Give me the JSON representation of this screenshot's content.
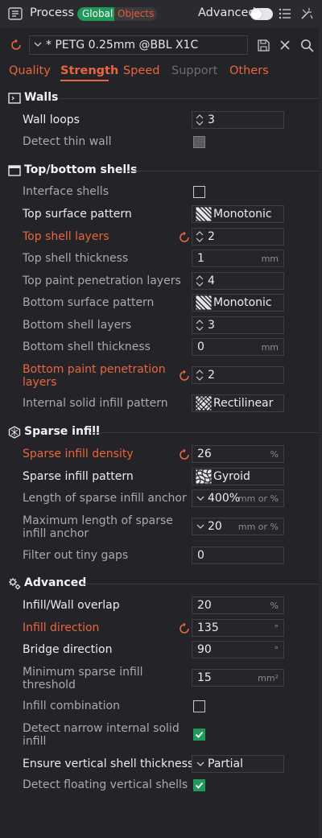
{
  "header": {
    "title": "Process",
    "seg_global": "Global",
    "seg_objects": "Objects",
    "advanced_label": "Advanced"
  },
  "preset": {
    "name": "* PETG 0.25mm @BBL X1C"
  },
  "tabs": [
    {
      "label": "Quality"
    },
    {
      "label": "Strength"
    },
    {
      "label": "Speed"
    },
    {
      "label": "Support"
    },
    {
      "label": "Others"
    }
  ],
  "sections": {
    "walls": "Walls",
    "topbottom": "Top/bottom shells",
    "sparse": "Sparse infill",
    "advanced": "Advanced"
  },
  "walls": {
    "wall_loops_label": "Wall loops",
    "wall_loops_value": "3",
    "detect_thin_label": "Detect thin wall"
  },
  "topbottom": {
    "interface_label": "Interface shells",
    "top_pattern_label": "Top surface pattern",
    "top_pattern_value": "Monotonic",
    "top_layers_label": "Top shell layers",
    "top_layers_value": "2",
    "top_thickness_label": "Top shell thickness",
    "top_thickness_value": "1",
    "top_thickness_unit": "mm",
    "top_paint_label": "Top paint penetration layers",
    "top_paint_value": "4",
    "bottom_pattern_label": "Bottom surface pattern",
    "bottom_pattern_value": "Monotonic",
    "bottom_layers_label": "Bottom shell layers",
    "bottom_layers_value": "3",
    "bottom_thickness_label": "Bottom shell thickness",
    "bottom_thickness_value": "0",
    "bottom_thickness_unit": "mm",
    "bottom_paint_label": "Bottom paint penetration layers",
    "bottom_paint_value": "2",
    "internal_pattern_label": "Internal solid infill pattern",
    "internal_pattern_value": "Rectilinear"
  },
  "sparse": {
    "density_label": "Sparse infill density",
    "density_value": "26",
    "density_unit": "%",
    "pattern_label": "Sparse infill pattern",
    "pattern_value": "Gyroid",
    "anchor_label": "Length of sparse infill anchor",
    "anchor_value": "400%",
    "anchor_unit": "mm or %",
    "max_anchor_label": "Maximum length of sparse infill anchor",
    "max_anchor_value": "20",
    "max_anchor_unit": "mm or %",
    "filter_gaps_label": "Filter out tiny gaps",
    "filter_gaps_value": "0"
  },
  "advanced": {
    "overlap_label": "Infill/Wall overlap",
    "overlap_value": "20",
    "overlap_unit": "%",
    "direction_label": "Infill direction",
    "direction_value": "135",
    "direction_unit": "°",
    "bridge_label": "Bridge direction",
    "bridge_value": "90",
    "bridge_unit": "°",
    "min_sparse_label": "Minimum sparse infill threshold",
    "min_sparse_value": "15",
    "min_sparse_unit": "mm²",
    "combination_label": "Infill combination",
    "narrow_label": "Detect narrow internal solid infill",
    "ensure_label": "Ensure vertical shell thickness",
    "ensure_value": "Partial",
    "floating_label": "Detect floating vertical shells"
  },
  "colors": {
    "accent": "#e8663d",
    "green": "#1f9a58",
    "background": "#242428"
  }
}
